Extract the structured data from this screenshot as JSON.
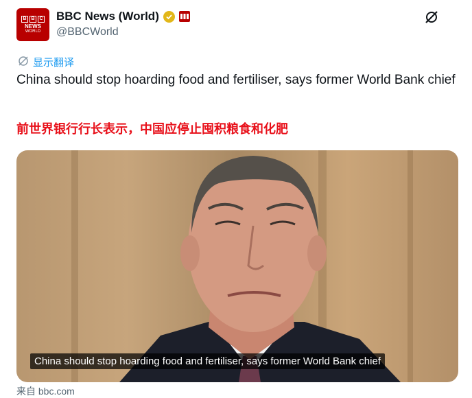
{
  "account": {
    "display_name": "BBC News (World)",
    "handle": "@BBCWorld",
    "avatar_lines": [
      "NEWS",
      "WORLD"
    ],
    "avatar_letters": [
      "B",
      "B",
      "C"
    ]
  },
  "icons": {
    "verified": "gold-check-icon",
    "affiliate": "bbc-affiliate-badge",
    "grok": "grok-icon",
    "translate": "translate-icon"
  },
  "translate": {
    "label": "显示翻译"
  },
  "tweet": {
    "text": "China should stop hoarding food and fertiliser, says former World Bank chief",
    "translation": "前世界银行行长表示，中国应停止囤积粮食和化肥"
  },
  "media": {
    "caption": "China should stop hoarding food and fertiliser, says former World Bank chief"
  },
  "source": {
    "label": "来自 bbc.com"
  },
  "colors": {
    "brand": "#b80000",
    "link": "#1d9bf0",
    "translation_red": "#e8101a",
    "verified_gold": "#e2b719"
  }
}
